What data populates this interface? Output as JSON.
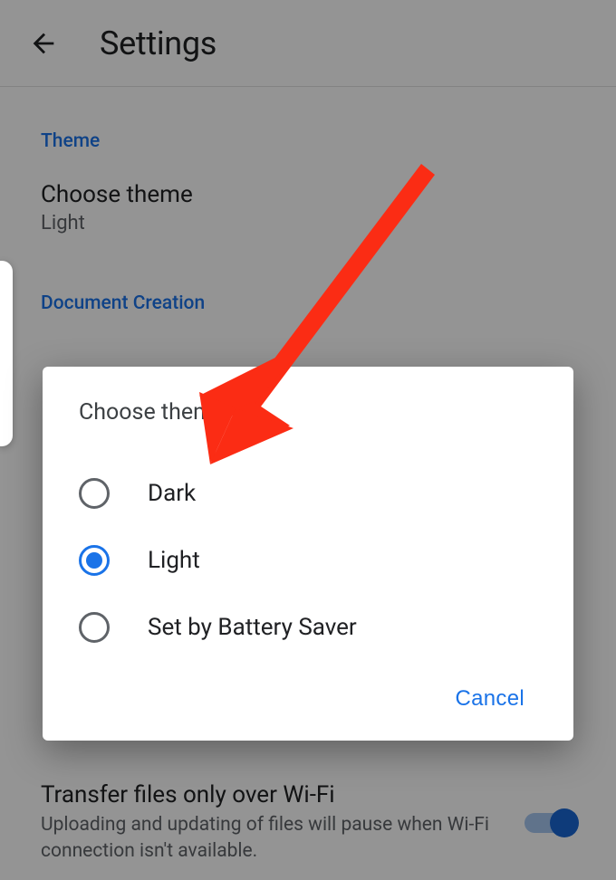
{
  "header": {
    "title": "Settings"
  },
  "sections": {
    "theme_header": "Theme",
    "doc_header": "Document Creation",
    "choose_theme_title": "Choose theme",
    "choose_theme_value": "Light"
  },
  "dialog": {
    "title": "Choose theme",
    "options": [
      "Dark",
      "Light",
      "Set by Battery Saver"
    ],
    "selected_index": 1,
    "cancel": "Cancel"
  },
  "bottom": {
    "title": "Transfer files only over Wi-Fi",
    "subtitle": "Uploading and updating of files will pause when Wi-Fi connection isn't available.",
    "toggle": true
  },
  "colors": {
    "accent": "#1a73e8",
    "arrow": "#fb2c14"
  }
}
